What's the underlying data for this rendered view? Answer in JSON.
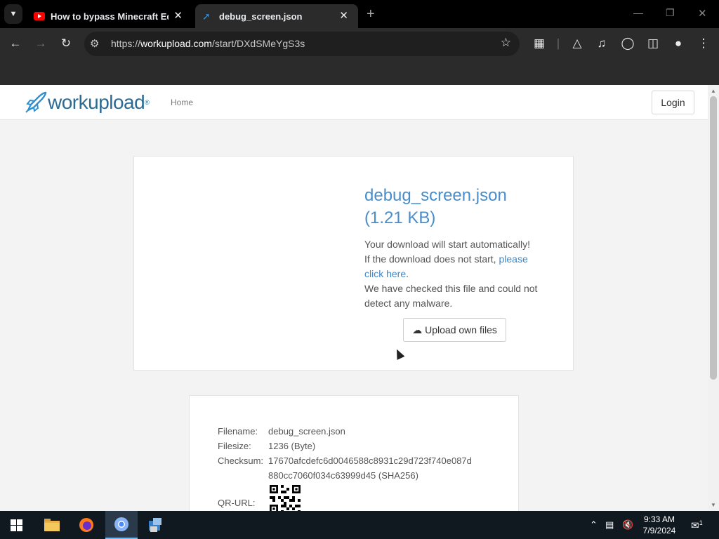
{
  "browser": {
    "tabs": [
      {
        "title": "How to bypass Minecraft Educ",
        "icon": "youtube-icon"
      },
      {
        "title": "debug_screen.json",
        "icon": "workupload-icon"
      }
    ],
    "url_scheme": "https://",
    "url_host": "workupload.com",
    "url_path": "/start/DXdSMeYgS3s"
  },
  "site": {
    "logo": "workupload",
    "nav_home": "Home",
    "login": "Login"
  },
  "file": {
    "title": "debug_screen.json",
    "size": "(1.21 KB)",
    "auto_msg": "Your download will start automatically!",
    "fallback_prefix": "If the download does not start, ",
    "fallback_link": "please click here",
    "fallback_suffix": ".",
    "malware_msg": "We have checked this file and could not detect any malware.",
    "upload_button": "Upload own files"
  },
  "details": {
    "filename_label": "Filename:",
    "filename": "debug_screen.json",
    "filesize_label": "Filesize:",
    "filesize": "1236 (Byte)",
    "checksum_label": "Checksum:",
    "checksum_line1": "17670afcdefc6d0046588c8931c29d723f740e087d",
    "checksum_line2": "880cc7060f034c63999d45 (SHA256)",
    "qr_label": "QR-URL:"
  },
  "taskbar": {
    "time": "9:33 AM",
    "date": "7/9/2024",
    "notification_count": "1"
  }
}
